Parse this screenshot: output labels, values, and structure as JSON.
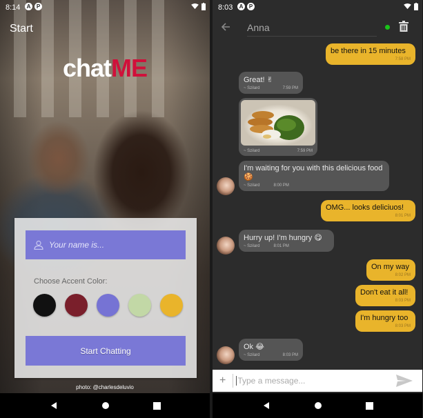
{
  "left": {
    "status": {
      "time": "8:14"
    },
    "screen_title": "Start",
    "logo": {
      "part1": "chat",
      "part2": "ME"
    },
    "name_placeholder": "Your name is...",
    "accent_label": "Choose Accent Color:",
    "accent_colors": [
      "#111111",
      "#7a1f2b",
      "#7673d4",
      "#c2d8a6",
      "#e9b42b"
    ],
    "start_button": "Start Chatting",
    "photo_credit": "photo: @charlesdeluvio"
  },
  "right": {
    "status": {
      "time": "8:03"
    },
    "contact": "Anna",
    "online_color": "#19c319",
    "messages": [
      {
        "dir": "out",
        "text": "be there in 15 minutes",
        "time": "7:58 PM"
      },
      {
        "dir": "in",
        "text": "Great! ✌",
        "sender": "~ Szilard",
        "time": "7:59 PM"
      },
      {
        "dir": "in",
        "image": "food-photo",
        "sender": "~ Szilard",
        "time": "7:59 PM"
      },
      {
        "dir": "in",
        "text": "I'm waiting for you with this delicious food 🍪",
        "sender": "~ Szilard",
        "time": "8:00 PM"
      },
      {
        "dir": "out",
        "text": "OMG... looks deliciuos!",
        "time": "8:01 PM"
      },
      {
        "dir": "in",
        "text": "Hurry up! I'm hungry 😋",
        "sender": "~ Szilard",
        "time": "8:01 PM"
      },
      {
        "dir": "out",
        "text": "On my way",
        "time": "8:02 PM"
      },
      {
        "dir": "out",
        "text": "Don't eat it all!",
        "time": "8:03 PM"
      },
      {
        "dir": "out",
        "text": "I'm hungry too",
        "time": "8:03 PM"
      },
      {
        "dir": "in",
        "text": "Ok 😂",
        "sender": "~ Szilard",
        "time": "8:03 PM"
      }
    ],
    "composer_placeholder": "Type a message..."
  }
}
